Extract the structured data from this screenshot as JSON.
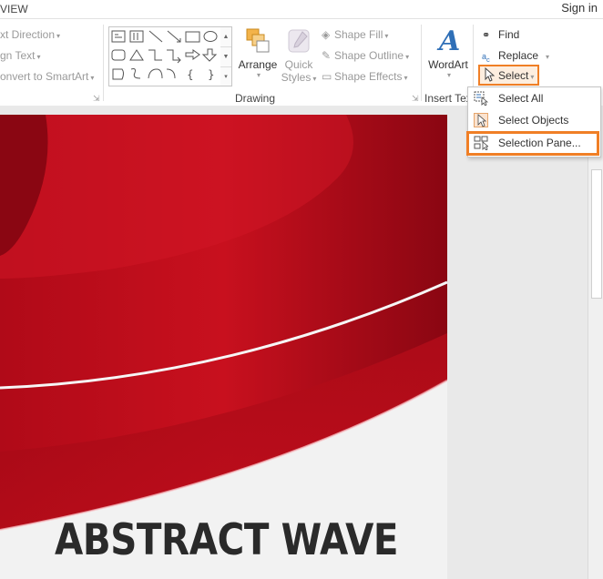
{
  "tabbar": {
    "active_tab": "VIEW",
    "sign_in": "Sign in"
  },
  "paragraph": {
    "text_direction": "xt Direction",
    "align_text": "gn Text",
    "convert_smartart": "onvert to SmartArt"
  },
  "drawing": {
    "group_label": "Drawing",
    "arrange": "Arrange",
    "quick": "Quick",
    "styles": "Styles",
    "shape_fill": "Shape Fill",
    "shape_outline": "Shape Outline",
    "shape_effects": "Shape Effects"
  },
  "insert_text": {
    "wordart": "WordArt",
    "group_label": "Insert Tex"
  },
  "editing": {
    "find": "Find",
    "replace": "Replace",
    "select": "Select"
  },
  "select_menu": {
    "items": [
      {
        "label": "Select All"
      },
      {
        "label": "Select Objects"
      },
      {
        "label": "Selection Pane..."
      }
    ]
  },
  "slide": {
    "title": "ABSTRACT WAVE"
  },
  "colors": {
    "accent_highlight": "#f07f26",
    "slide_red": "#c8101e"
  }
}
